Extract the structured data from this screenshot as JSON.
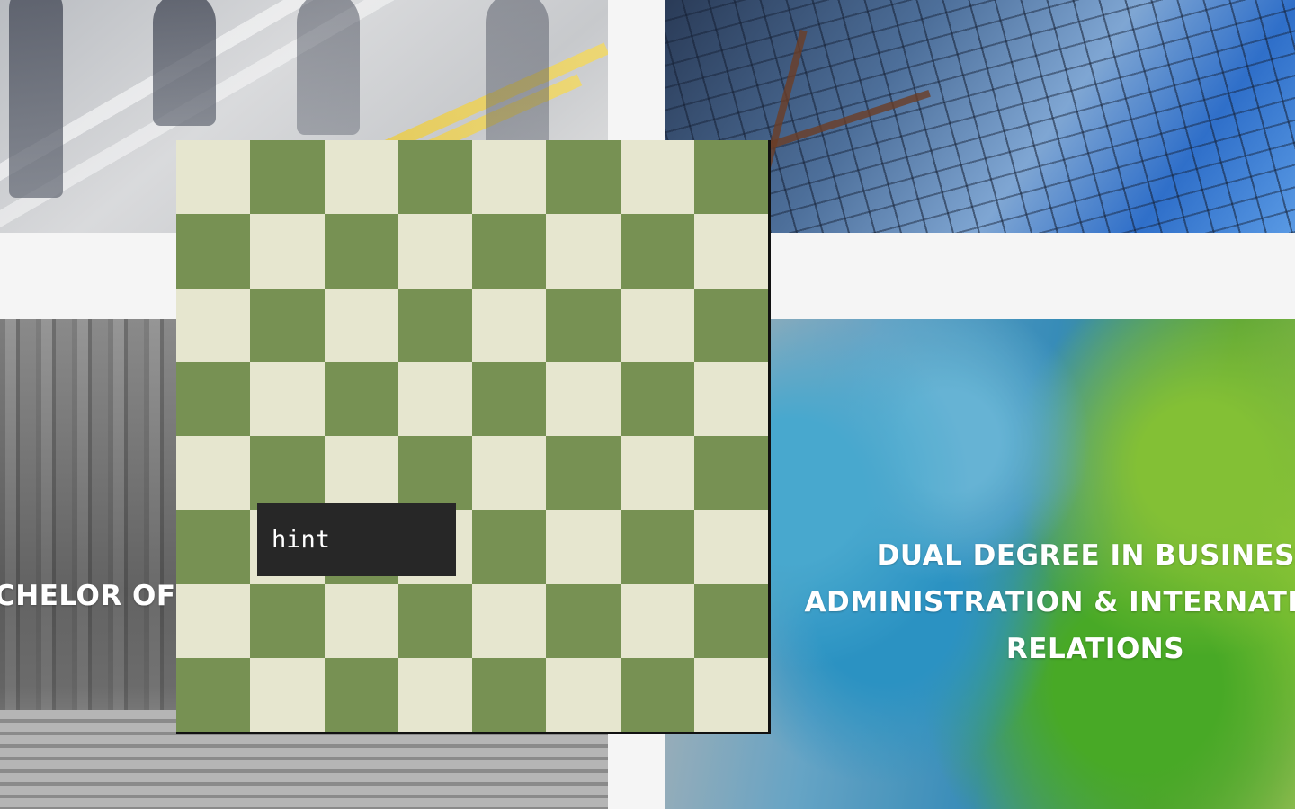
{
  "background": {
    "tiles": [
      {
        "name": "people-walking-photo"
      },
      {
        "name": "glass-building-photo"
      },
      {
        "name": "stone-columns-photo"
      },
      {
        "name": "blue-green-ink-photo"
      }
    ],
    "left_card_title": "CHELOR OF",
    "right_card_title": [
      "DUAL DEGREE IN BUSINESS",
      "ADMINISTRATION & INTERNATIONAL",
      "RELATIONS"
    ]
  },
  "board": {
    "rows": 8,
    "cols": 8,
    "colors": {
      "light": "#e6e6cf",
      "dark": "#779153"
    },
    "top_left_color": "light"
  },
  "hint": {
    "label": "hint",
    "background": "#272727"
  }
}
